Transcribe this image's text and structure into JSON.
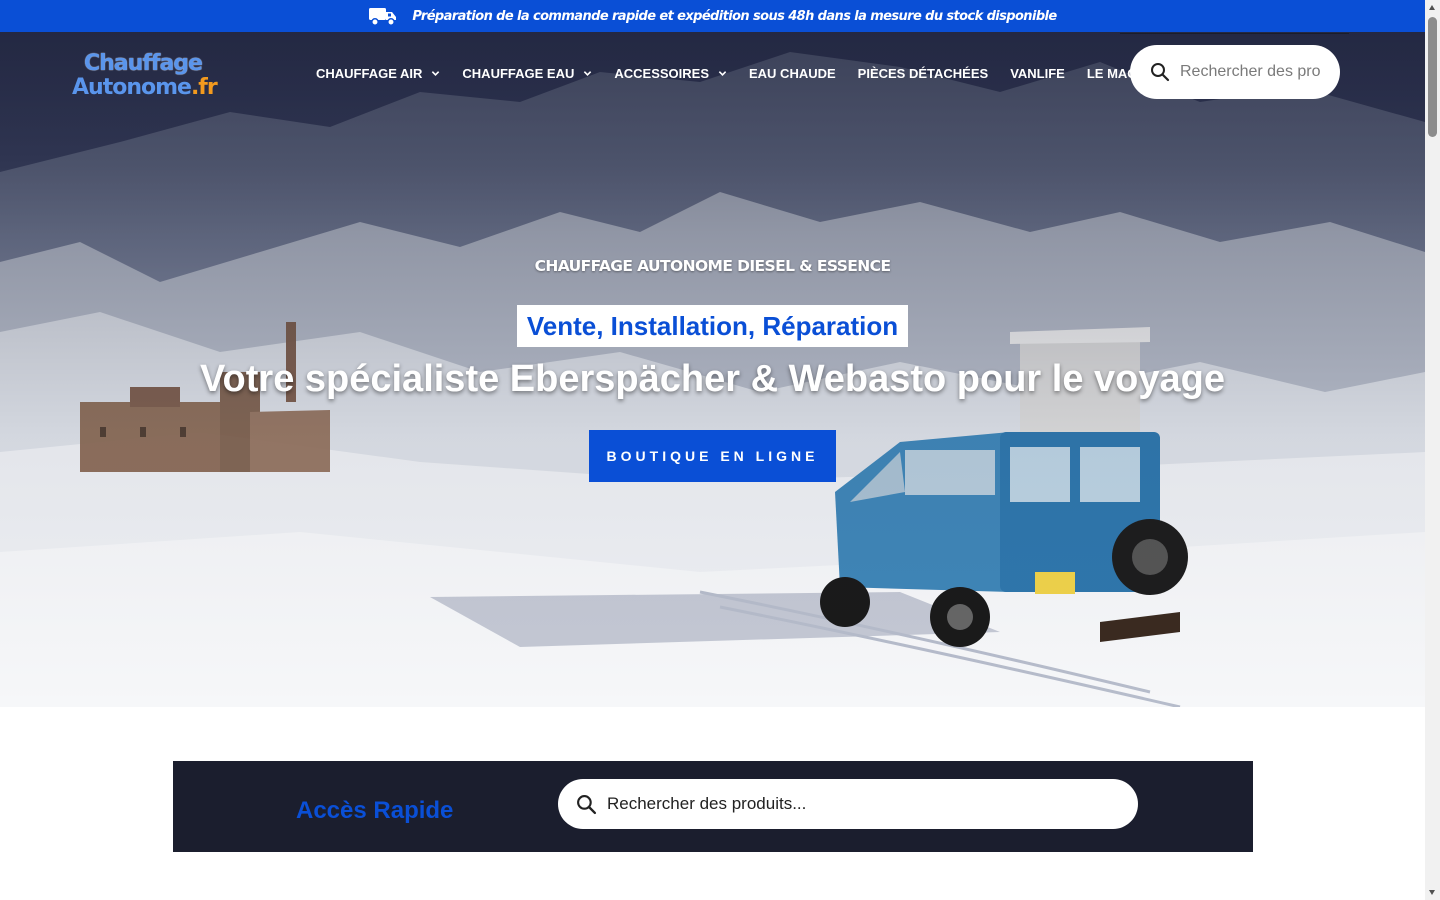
{
  "announcement": {
    "text": "Préparation de la commande rapide et expédition sous 48h dans la mesure du stock disponible"
  },
  "logo": {
    "line1": "Chauffage",
    "line2a": "Autonome",
    "line2b": ".fr"
  },
  "nav": {
    "items": [
      {
        "label": "CHAUFFAGE AIR",
        "has_dropdown": true
      },
      {
        "label": "CHAUFFAGE EAU",
        "has_dropdown": true
      },
      {
        "label": "ACCESSOIRES",
        "has_dropdown": true
      },
      {
        "label": "EAU CHAUDE",
        "has_dropdown": false
      },
      {
        "label": "PIÈCES DÉTACHÉES",
        "has_dropdown": false
      },
      {
        "label": "VANLIFE",
        "has_dropdown": false
      },
      {
        "label": "LE MAG",
        "has_dropdown": true
      }
    ]
  },
  "header_search": {
    "placeholder": "Rechercher des produits..."
  },
  "hero": {
    "kicker": "CHAUFFAGE AUTONOME DIESEL & ESSENCE",
    "tagline": "Vente, Installation, Réparation",
    "headline": "Votre spécialiste Eberspächer & Webasto pour le voyage",
    "cta_label": "BOUTIQUE EN LIGNE"
  },
  "quick_access": {
    "title": "Accès Rapide",
    "search_placeholder": "Rechercher des produits..."
  },
  "colors": {
    "brand_blue": "#0a4fd6",
    "dark_navy": "#1b1e2e",
    "logo_orange": "#f39a1e",
    "logo_blue": "#5a95ec"
  }
}
